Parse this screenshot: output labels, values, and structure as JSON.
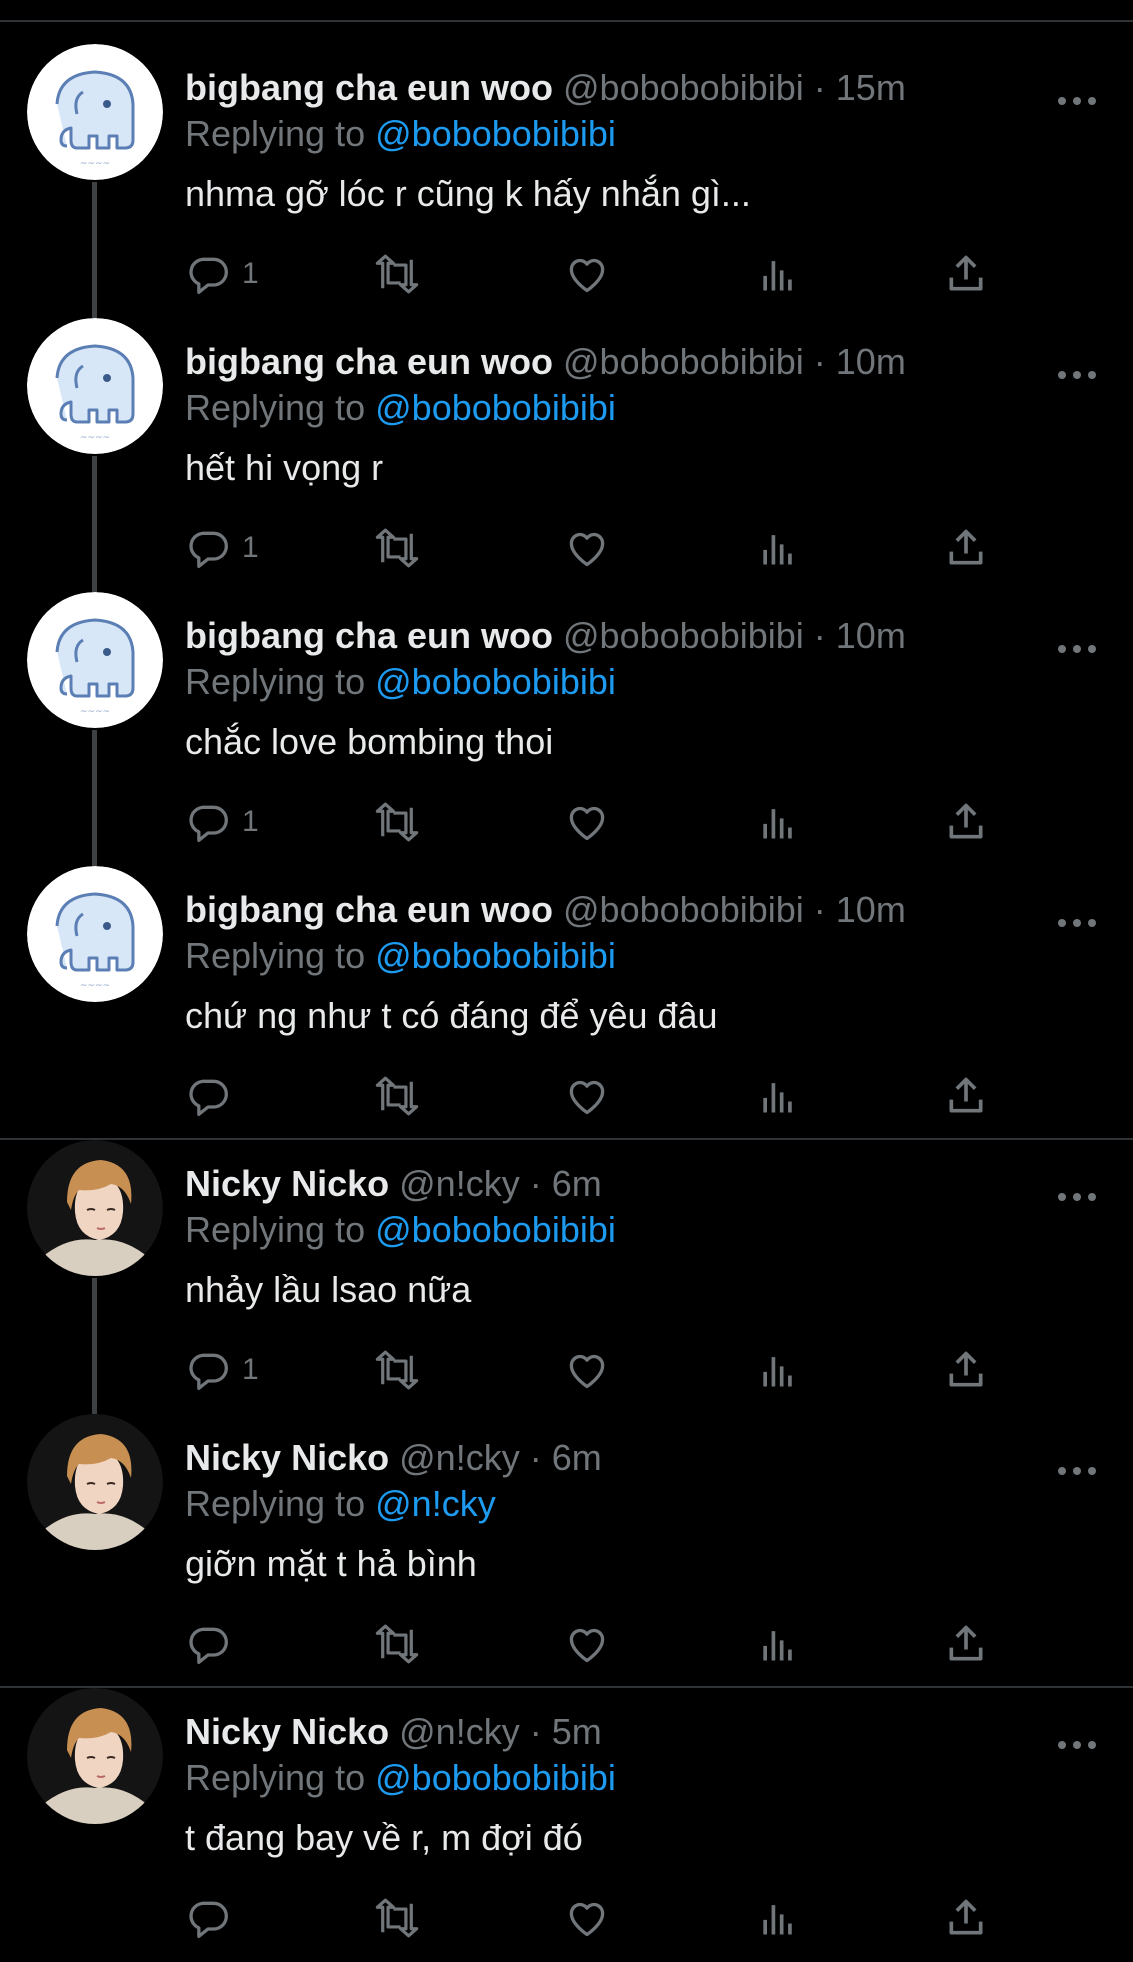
{
  "tweets": [
    {
      "name": "bigbang cha eun woo",
      "handle": "@bobobobibibi",
      "time": "15m",
      "replying_label": "Replying to",
      "replying_to": "@bobobobibibi",
      "text": "nhma gỡ lóc r cũng k hấy nhắn gì...",
      "reply_count": "1",
      "avatar": "elephant"
    },
    {
      "name": "bigbang cha eun woo",
      "handle": "@bobobobibibi",
      "time": "10m",
      "replying_label": "Replying to",
      "replying_to": "@bobobobibibi",
      "text": "hết hi vọng r",
      "reply_count": "1",
      "avatar": "elephant"
    },
    {
      "name": "bigbang cha eun woo",
      "handle": "@bobobobibibi",
      "time": "10m",
      "replying_label": "Replying to",
      "replying_to": "@bobobobibibi",
      "text": "chắc love bombing thoi",
      "reply_count": "1",
      "avatar": "elephant"
    },
    {
      "name": "bigbang cha eun woo",
      "handle": "@bobobobibibi",
      "time": "10m",
      "replying_label": "Replying to",
      "replying_to": "@bobobobibibi",
      "text": "chứ ng như t có đáng để yêu đâu",
      "reply_count": "",
      "avatar": "elephant"
    },
    {
      "name": "Nicky Nicko",
      "handle": "@n!cky",
      "time": "6m",
      "replying_label": "Replying to",
      "replying_to": "@bobobobibibi",
      "text": "nhảy lầu lsao nữa",
      "reply_count": "1",
      "avatar": "person"
    },
    {
      "name": "Nicky Nicko",
      "handle": "@n!cky",
      "time": "6m",
      "replying_label": "Replying to",
      "replying_to": "@n!cky",
      "text": "giỡn mặt t hả bình",
      "reply_count": "",
      "avatar": "person"
    },
    {
      "name": "Nicky Nicko",
      "handle": "@n!cky",
      "time": "5m",
      "replying_label": "Replying to",
      "replying_to": "@bobobobibibi",
      "text": "t đang bay về r, m đợi đó",
      "reply_count": "",
      "avatar": "person"
    }
  ],
  "separator": "·",
  "icons": {
    "reply": "reply-icon",
    "retweet": "retweet-icon",
    "like": "heart-icon",
    "views": "views-icon",
    "share": "share-icon",
    "more": "more-icon"
  },
  "colors": {
    "background": "#000000",
    "text": "#e7e9ea",
    "secondary": "#71767b",
    "link": "#1d9bf0",
    "divider": "#2f3336"
  }
}
